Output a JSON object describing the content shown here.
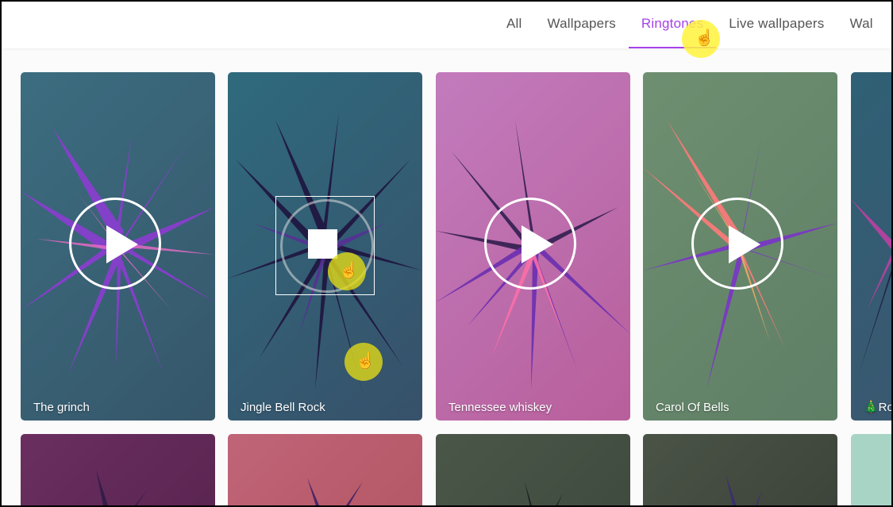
{
  "nav": {
    "tabs": [
      {
        "label": "All"
      },
      {
        "label": "Wallpapers"
      },
      {
        "label": "Ringtones",
        "active": true
      },
      {
        "label": "Live wallpapers"
      },
      {
        "label": "Wal"
      }
    ]
  },
  "cards": [
    {
      "title": "The grinch",
      "state": "play"
    },
    {
      "title": "Jingle Bell Rock",
      "state": "stop"
    },
    {
      "title": "Tennessee whiskey",
      "state": "play"
    },
    {
      "title": "Carol Of Bells",
      "state": "play"
    },
    {
      "title": "🎄Ro"
    }
  ],
  "colors": {
    "accent": "#a642e8",
    "card1_bg": "#3d6a7c",
    "card2_bg": "#2f5d6f",
    "card3_bg": "#c677b7",
    "card4_bg": "#6d8f6e",
    "card5_bg": "#2f5d70"
  }
}
